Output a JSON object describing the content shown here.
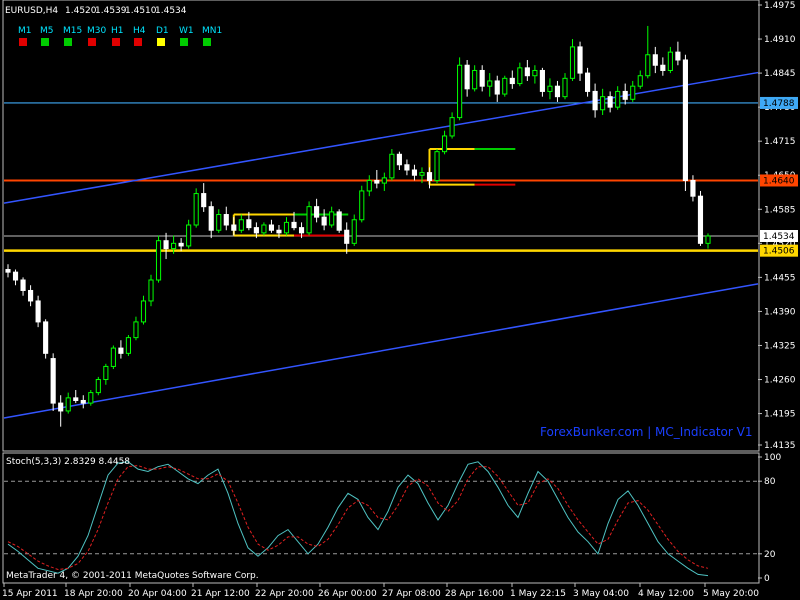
{
  "chart_data": [
    {
      "type": "candlestick",
      "title": "EURUSD,H4",
      "ohlc_header": [
        "1.4520",
        "1.4539",
        "1.4510",
        "1.4534"
      ],
      "timeframes": [
        {
          "label": "M1",
          "status_color": "#e00000"
        },
        {
          "label": "M5",
          "status_color": "#00cc00"
        },
        {
          "label": "M15",
          "status_color": "#00cc00"
        },
        {
          "label": "M30",
          "status_color": "#e00000"
        },
        {
          "label": "H1",
          "status_color": "#e00000"
        },
        {
          "label": "H4",
          "status_color": "#e00000"
        },
        {
          "label": "D1",
          "status_color": "#ffff00"
        },
        {
          "label": "W1",
          "status_color": "#00cc00"
        },
        {
          "label": "MN1",
          "status_color": "#00cc00"
        }
      ],
      "y_ticks": [
        "1.4975",
        "1.4910",
        "1.4845",
        "1.4780",
        "1.4715",
        "1.4650",
        "1.4585",
        "1.4520",
        "1.4455",
        "1.4390",
        "1.4325",
        "1.4260",
        "1.4195",
        "1.4135"
      ],
      "ylim": [
        1.4135,
        1.4975
      ],
      "price_levels": [
        {
          "label": "1.4788",
          "value": 1.4788,
          "color": "#3fa9f5",
          "label_bg": "#3fa9f5",
          "label_fg": "#000000"
        },
        {
          "label": "1.4640",
          "value": 1.464,
          "color": "#ff4500",
          "label_bg": "#ff4500",
          "label_fg": "#000000"
        },
        {
          "label": "1.4534",
          "value": 1.4534,
          "color": "#9a9a9a",
          "label_bg": "#ffffff",
          "label_fg": "#000000"
        },
        {
          "label": "1.4506",
          "value": 1.4506,
          "color": "#ffd700",
          "label_bg": "#ffd700",
          "label_fg": "#000000"
        }
      ],
      "channel_color": "#3355ff",
      "watermark": "ForexBunker.com | MC_Indicator V1",
      "watermark_color": "#1a3fff",
      "bull_color": "#00ff00",
      "bear_color": "#ffffff",
      "candle_wick_color": "#00ff00",
      "candles": [
        [
          1.447,
          1.448,
          1.4455,
          1.4465
        ],
        [
          1.4465,
          1.447,
          1.444,
          1.445
        ],
        [
          1.445,
          1.4455,
          1.442,
          1.443
        ],
        [
          1.443,
          1.444,
          1.44,
          1.441
        ],
        [
          1.441,
          1.442,
          1.436,
          1.437
        ],
        [
          1.437,
          1.4375,
          1.43,
          1.431
        ],
        [
          1.43,
          1.431,
          1.42,
          1.4215
        ],
        [
          1.4215,
          1.423,
          1.417,
          1.42
        ],
        [
          1.42,
          1.4235,
          1.4195,
          1.4225
        ],
        [
          1.4225,
          1.424,
          1.4215,
          1.422
        ],
        [
          1.422,
          1.423,
          1.4205,
          1.4215
        ],
        [
          1.4215,
          1.424,
          1.421,
          1.4235
        ],
        [
          1.4235,
          1.4265,
          1.423,
          1.426
        ],
        [
          1.426,
          1.429,
          1.425,
          1.4285
        ],
        [
          1.4285,
          1.4325,
          1.428,
          1.432
        ],
        [
          1.432,
          1.4335,
          1.43,
          1.431
        ],
        [
          1.431,
          1.4345,
          1.4305,
          1.434
        ],
        [
          1.434,
          1.438,
          1.4335,
          1.437
        ],
        [
          1.437,
          1.442,
          1.4365,
          1.441
        ],
        [
          1.441,
          1.446,
          1.44,
          1.445
        ],
        [
          1.445,
          1.4535,
          1.4445,
          1.4525
        ],
        [
          1.4525,
          1.454,
          1.449,
          1.451
        ],
        [
          1.451,
          1.4535,
          1.45,
          1.452
        ],
        [
          1.452,
          1.453,
          1.4505,
          1.4515
        ],
        [
          1.4515,
          1.4565,
          1.451,
          1.4555
        ],
        [
          1.4555,
          1.4625,
          1.455,
          1.4615
        ],
        [
          1.4615,
          1.4635,
          1.458,
          1.459
        ],
        [
          1.459,
          1.46,
          1.453,
          1.4545
        ],
        [
          1.4545,
          1.4585,
          1.454,
          1.4575
        ],
        [
          1.4575,
          1.459,
          1.4545,
          1.4555
        ],
        [
          1.4555,
          1.457,
          1.4535,
          1.4545
        ],
        [
          1.4545,
          1.4575,
          1.454,
          1.4565
        ],
        [
          1.4565,
          1.458,
          1.4545,
          1.455
        ],
        [
          1.455,
          1.456,
          1.453,
          1.454
        ],
        [
          1.454,
          1.456,
          1.4535,
          1.4555
        ],
        [
          1.4555,
          1.4565,
          1.454,
          1.4545
        ],
        [
          1.4545,
          1.4555,
          1.453,
          1.454
        ],
        [
          1.454,
          1.457,
          1.4535,
          1.456
        ],
        [
          1.456,
          1.458,
          1.4545,
          1.455
        ],
        [
          1.455,
          1.456,
          1.453,
          1.454
        ],
        [
          1.454,
          1.46,
          1.4535,
          1.459
        ],
        [
          1.459,
          1.4605,
          1.456,
          1.457
        ],
        [
          1.457,
          1.4585,
          1.4545,
          1.4555
        ],
        [
          1.4555,
          1.459,
          1.455,
          1.458
        ],
        [
          1.458,
          1.4585,
          1.454,
          1.4545
        ],
        [
          1.4545,
          1.456,
          1.45,
          1.452
        ],
        [
          1.452,
          1.4575,
          1.4515,
          1.4565
        ],
        [
          1.4565,
          1.463,
          1.456,
          1.462
        ],
        [
          1.462,
          1.465,
          1.461,
          1.464
        ],
        [
          1.464,
          1.466,
          1.4625,
          1.4635
        ],
        [
          1.4635,
          1.4655,
          1.462,
          1.4645
        ],
        [
          1.4645,
          1.47,
          1.464,
          1.469
        ],
        [
          1.469,
          1.4695,
          1.466,
          1.467
        ],
        [
          1.467,
          1.468,
          1.465,
          1.466
        ],
        [
          1.466,
          1.467,
          1.464,
          1.465
        ],
        [
          1.465,
          1.4665,
          1.4635,
          1.4655
        ],
        [
          1.4655,
          1.4665,
          1.4625,
          1.464
        ],
        [
          1.464,
          1.47,
          1.4635,
          1.4695
        ],
        [
          1.4695,
          1.4735,
          1.469,
          1.4725
        ],
        [
          1.4725,
          1.477,
          1.472,
          1.476
        ],
        [
          1.476,
          1.4875,
          1.4755,
          1.486
        ],
        [
          1.486,
          1.487,
          1.48,
          1.4815
        ],
        [
          1.4815,
          1.486,
          1.481,
          1.485
        ],
        [
          1.485,
          1.486,
          1.481,
          1.482
        ],
        [
          1.482,
          1.4845,
          1.48,
          1.483
        ],
        [
          1.483,
          1.484,
          1.479,
          1.4805
        ],
        [
          1.4805,
          1.484,
          1.48,
          1.4835
        ],
        [
          1.4835,
          1.485,
          1.4815,
          1.4825
        ],
        [
          1.4825,
          1.4865,
          1.482,
          1.4855
        ],
        [
          1.4855,
          1.487,
          1.483,
          1.484
        ],
        [
          1.484,
          1.486,
          1.4825,
          1.485
        ],
        [
          1.485,
          1.4855,
          1.48,
          1.481
        ],
        [
          1.481,
          1.4835,
          1.4795,
          1.482
        ],
        [
          1.482,
          1.483,
          1.479,
          1.48
        ],
        [
          1.48,
          1.4845,
          1.4795,
          1.4835
        ],
        [
          1.4835,
          1.491,
          1.483,
          1.4895
        ],
        [
          1.4895,
          1.4905,
          1.483,
          1.4845
        ],
        [
          1.4845,
          1.4855,
          1.48,
          1.481
        ],
        [
          1.481,
          1.4825,
          1.476,
          1.4775
        ],
        [
          1.4775,
          1.4815,
          1.4765,
          1.48
        ],
        [
          1.48,
          1.481,
          1.477,
          1.478
        ],
        [
          1.478,
          1.482,
          1.4775,
          1.481
        ],
        [
          1.481,
          1.4825,
          1.4785,
          1.4795
        ],
        [
          1.4795,
          1.483,
          1.479,
          1.482
        ],
        [
          1.482,
          1.485,
          1.4815,
          1.484
        ],
        [
          1.484,
          1.4935,
          1.4835,
          1.488
        ],
        [
          1.488,
          1.4895,
          1.4845,
          1.486
        ],
        [
          1.486,
          1.4875,
          1.484,
          1.485
        ],
        [
          1.485,
          1.4895,
          1.4845,
          1.4885
        ],
        [
          1.4885,
          1.4905,
          1.486,
          1.487
        ],
        [
          1.487,
          1.488,
          1.462,
          1.464
        ],
        [
          1.464,
          1.465,
          1.46,
          1.461
        ],
        [
          1.461,
          1.462,
          1.4515,
          1.452
        ],
        [
          1.452,
          1.4539,
          1.451,
          1.4534
        ]
      ],
      "x_tick_labels": [
        "15 Apr 2011",
        "18 Apr 20:00",
        "20 Apr 04:00",
        "21 Apr 12:00",
        "22 Apr 20:00",
        "26 Apr 00:00",
        "27 Apr 08:00",
        "28 Apr 16:00",
        "1 May 22:15",
        "3 May 04:00",
        "4 May 12:00",
        "5 May 20:00"
      ],
      "copyright": "MetaTrader 4, © 2001-2011 MetaQuotes Software Corp."
    },
    {
      "type": "line",
      "title": "Stoch(5,3,3) 2.8329 8.4458",
      "ylim": [
        0,
        100
      ],
      "y_ticks": [
        "100",
        "80",
        "20",
        "0"
      ],
      "levels": [
        80,
        20
      ],
      "series": [
        {
          "color": "#4fc3c3",
          "values": [
            28,
            22,
            15,
            8,
            6,
            4,
            8,
            18,
            35,
            60,
            85,
            95,
            96,
            90,
            88,
            92,
            94,
            88,
            82,
            78,
            85,
            90,
            70,
            45,
            25,
            18,
            25,
            35,
            40,
            30,
            20,
            28,
            42,
            58,
            70,
            65,
            50,
            40,
            55,
            75,
            85,
            78,
            62,
            48,
            60,
            78,
            94,
            96,
            88,
            75,
            60,
            50,
            70,
            88,
            80,
            65,
            50,
            38,
            30,
            20,
            45,
            65,
            72,
            60,
            45,
            30,
            20,
            14,
            8,
            3,
            2
          ]
        },
        {
          "color": "#e02020",
          "values": [
            30,
            26,
            20,
            14,
            10,
            7,
            8,
            12,
            22,
            40,
            62,
            82,
            92,
            93,
            90,
            90,
            92,
            90,
            86,
            82,
            82,
            86,
            80,
            62,
            42,
            28,
            23,
            27,
            34,
            34,
            28,
            26,
            32,
            44,
            58,
            64,
            60,
            50,
            48,
            60,
            76,
            82,
            76,
            62,
            55,
            64,
            82,
            92,
            92,
            84,
            72,
            60,
            62,
            78,
            82,
            74,
            60,
            48,
            38,
            28,
            32,
            48,
            62,
            64,
            56,
            44,
            32,
            22,
            15,
            10,
            8
          ]
        }
      ]
    }
  ]
}
